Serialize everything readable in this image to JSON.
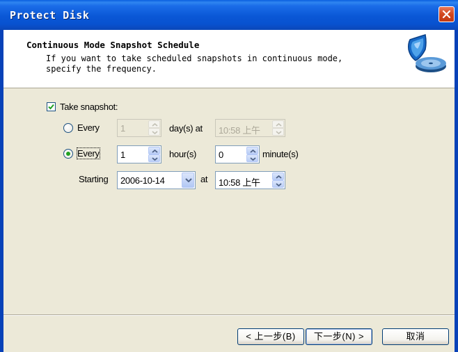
{
  "window": {
    "title": "Protect Disk",
    "close_icon": "close-icon"
  },
  "header": {
    "title": "Continuous Mode Snapshot Schedule",
    "description": "If you want to take scheduled snapshots in continuous mode,\nspecify the frequency.",
    "icon": "shield-disk-icon"
  },
  "form": {
    "take_snapshot": {
      "label": "Take snapshot:",
      "checked": true
    },
    "every_day": {
      "label": "Every",
      "selected": false,
      "days_value": "1",
      "days_unit": "day(s) at",
      "time_value": "10:58 上午"
    },
    "every_hour": {
      "label": "Every",
      "selected": true,
      "hours_value": "1",
      "hours_unit": "hour(s)",
      "minutes_value": "0",
      "minutes_unit": "minute(s)"
    },
    "starting": {
      "label": "Starting",
      "date_value": "2006-10-14",
      "at_label": "at",
      "time_value": "10:58 上午"
    }
  },
  "buttons": {
    "back": "< 上一步(B)",
    "next": "下一步(N) >",
    "cancel": "取消"
  },
  "colors": {
    "titlebar": "#0a57d6",
    "dialog_bg": "#ece9d8",
    "accent_check": "#21a121"
  }
}
